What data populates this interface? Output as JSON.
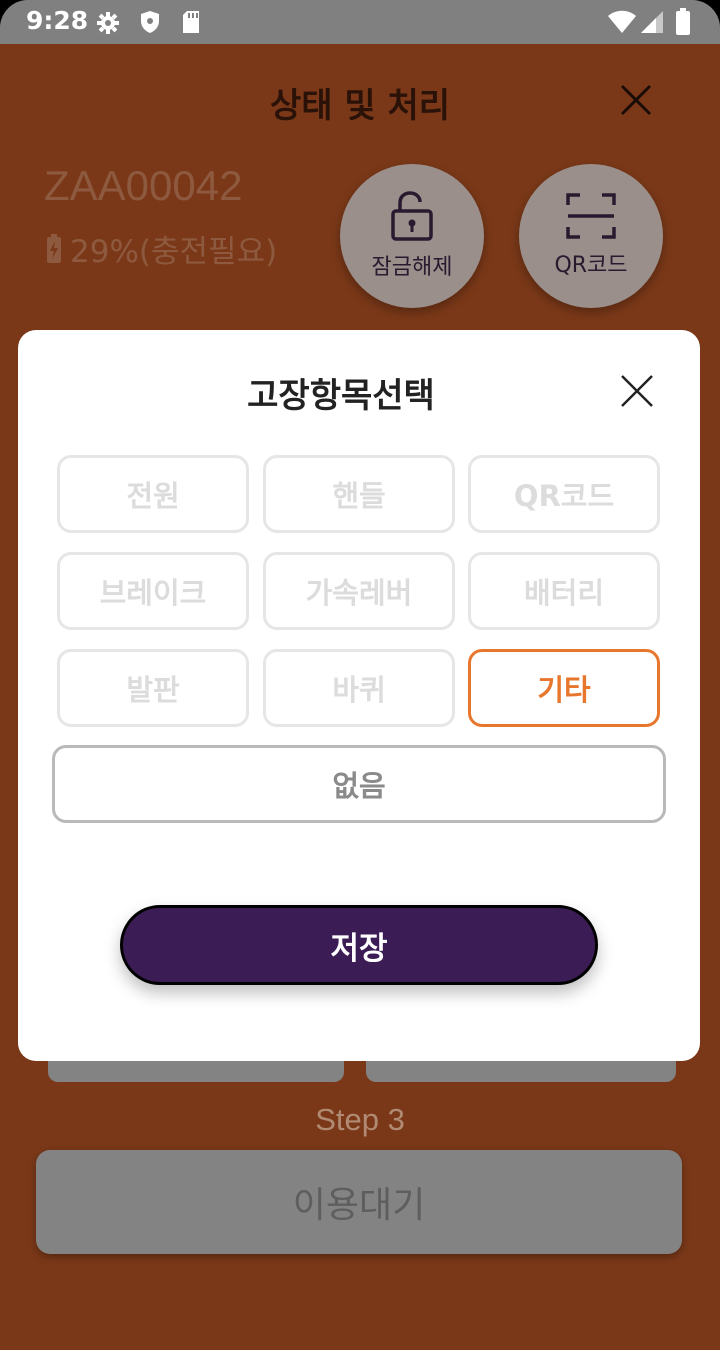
{
  "status_bar": {
    "time": "9:28",
    "icons": [
      "gear-icon",
      "shield-icon",
      "sd-card-icon",
      "wifi-icon",
      "signal-icon",
      "battery-icon"
    ]
  },
  "header": {
    "title": "상태 및 처리"
  },
  "device": {
    "id": "ZAA00042",
    "battery_text": "29%(충전필요)"
  },
  "actions": {
    "unlock_label": "잠금해제",
    "qr_label": "QR코드"
  },
  "modal": {
    "title": "고장항목선택",
    "options": [
      "전원",
      "핸들",
      "QR코드",
      "브레이크",
      "가속레버",
      "배터리",
      "발판",
      "바퀴",
      "기타"
    ],
    "selected": "기타",
    "none_label": "없음",
    "save_label": "저장"
  },
  "background": {
    "step_label": "Step 3",
    "wait_button": "이용대기"
  },
  "colors": {
    "background": "#7a3818",
    "accent": "#e8772e",
    "primary": "#3b1c55"
  }
}
